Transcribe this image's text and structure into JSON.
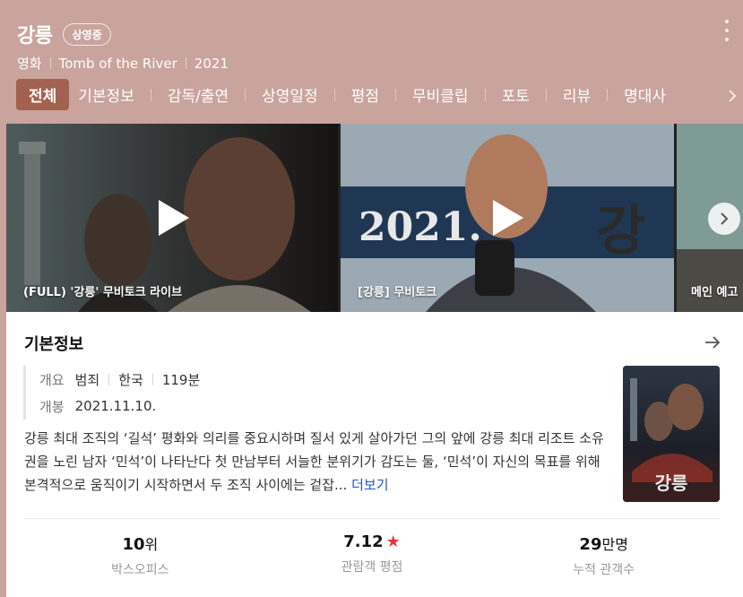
{
  "header": {
    "title": "강릉",
    "badge": "상영중",
    "meta": [
      "영화",
      "Tomb of the River",
      "2021"
    ]
  },
  "tabs": [
    "전체",
    "기본정보",
    "감독/출연",
    "상영일정",
    "평점",
    "무비클립",
    "포토",
    "리뷰",
    "명대사"
  ],
  "videos": [
    {
      "title": "(FULL) '강릉' 무비토크 라이브"
    },
    {
      "title": "[강릉] 무비토크"
    },
    {
      "title": "메인 예고"
    }
  ],
  "poster_text": "2021.",
  "info": {
    "section_title": "기본정보",
    "overview_label": "개요",
    "genre": "범죄",
    "country": "한국",
    "runtime": "119분",
    "release_label": "개봉",
    "release_date": "2021.11.10.",
    "synopsis": "강릉 최대 조직의 ‘길석’ 평화와 의리를 중요시하며 질서 있게 살아가던 그의 앞에 강릉 최대 리조트 소유권을 노린 남자 ‘민석’이 나타난다 첫 만남부터 서늘한 분위기가 감도는 둘, ‘민석’이 자신의 목표를 위해 본격적으로 움직이기 시작하면서 두 조직 사이에는 겉잡...",
    "more_label": "더보기"
  },
  "stats": [
    {
      "value": "10",
      "unit": "위",
      "label": "박스오피스"
    },
    {
      "value": "7.12",
      "unit": "",
      "label": "관람객 평점"
    },
    {
      "value": "29",
      "unit": "만명",
      "label": "누적 관객수"
    }
  ],
  "colors": {
    "header_bg": "#c9a49c",
    "active_tab": "#a3614f",
    "star": "#e8323c",
    "link": "#2456c5"
  }
}
